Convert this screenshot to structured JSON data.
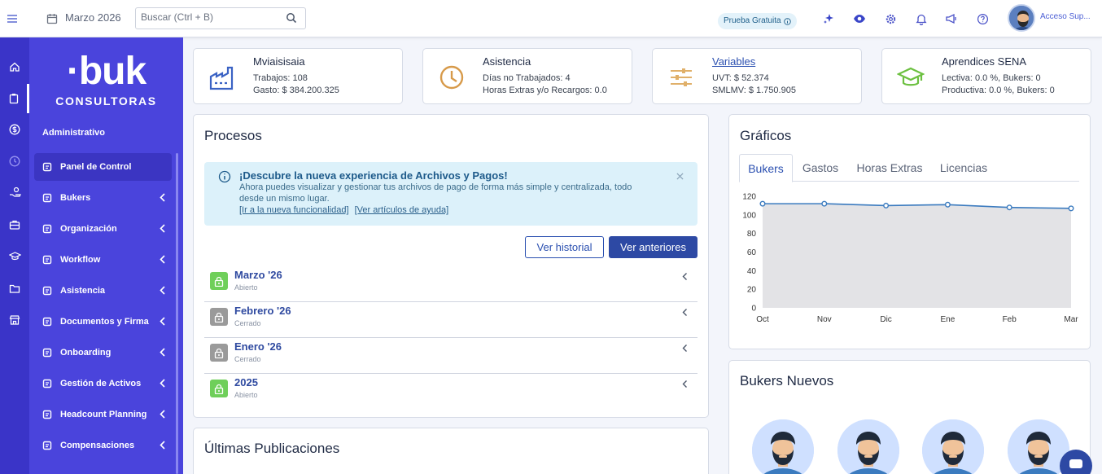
{
  "topbar": {
    "month": "Marzo 2026",
    "search_placeholder": "Buscar (Ctrl + B)",
    "trial_badge": "Prueba Gratuita",
    "user_name": "Acceso Sup..."
  },
  "sidebar": {
    "brand_name": "·buk",
    "brand_sub": "CONSULTORAS",
    "section_label": "Administrativo",
    "items": [
      {
        "label": "Panel de Control",
        "icon": "dashboard-icon",
        "active": true
      },
      {
        "label": "Bukers",
        "icon": "users-icon"
      },
      {
        "label": "Organización",
        "icon": "org-chart-icon"
      },
      {
        "label": "Workflow",
        "icon": "workflow-icon"
      },
      {
        "label": "Asistencia",
        "icon": "calendar-check-icon"
      },
      {
        "label": "Documentos y Firma",
        "icon": "documents-icon"
      },
      {
        "label": "Onboarding",
        "icon": "onboarding-icon"
      },
      {
        "label": "Gestión de Activos",
        "icon": "assets-icon"
      },
      {
        "label": "Headcount Planning",
        "icon": "headcount-icon"
      },
      {
        "label": "Compensaciones",
        "icon": "money-icon"
      }
    ]
  },
  "stats": [
    {
      "title": "Mviaisisaia",
      "line1": "Trabajos: 108",
      "line2": "Gasto: $ 384.200.325",
      "icon": "factory-icon"
    },
    {
      "title": "Asistencia",
      "line1": "Días no Trabajados: 4",
      "line2": "Horas Extras y/o Recargos: 0.0",
      "icon": "clock-icon"
    },
    {
      "title": "Variables",
      "line1": "UVT: $ 52.374",
      "line2": "SMLMV: $ 1.750.905",
      "icon": "sliders-icon"
    },
    {
      "title": "Aprendices SENA",
      "line1": "Lectiva: 0.0 %, Bukers: 0",
      "line2": "Productiva: 0.0 %, Bukers: 0",
      "icon": "graduation-cap-icon"
    }
  ],
  "procesos": {
    "title": "Procesos",
    "banner": {
      "title": "¡Descubre la nueva experiencia de Archivos y Pagos!",
      "text": "Ahora puedes visualizar y gestionar tus archivos de pago de forma más simple y centralizada, todo desde un mismo lugar.",
      "link1": "[Ir a la nueva funcionalidad]",
      "link2": "[Ver artículos de ayuda]"
    },
    "btn_historial": "Ver historial",
    "btn_anteriores": "Ver anteriores",
    "items": [
      {
        "name": "Marzo '26",
        "status": "Abierto",
        "open": true
      },
      {
        "name": "Febrero '26",
        "status": "Cerrado",
        "open": false
      },
      {
        "name": "Enero '26",
        "status": "Cerrado",
        "open": false
      },
      {
        "name": "2025",
        "status": "Abierto",
        "open": true
      }
    ]
  },
  "publicaciones": {
    "title": "Últimas Publicaciones"
  },
  "graficos": {
    "title": "Gráficos",
    "tabs": [
      "Bukers",
      "Gastos",
      "Horas Extras",
      "Licencias"
    ],
    "active_tab": "Bukers"
  },
  "chart_data": {
    "type": "area",
    "x": [
      "Oct",
      "Nov",
      "Dic",
      "Ene",
      "Feb",
      "Mar"
    ],
    "values": [
      112,
      112,
      110,
      111,
      108,
      107
    ],
    "ylim": [
      0,
      120
    ],
    "yticks": [
      0,
      20,
      40,
      60,
      80,
      100,
      120
    ],
    "grid": false,
    "line_color": "#3b7bbf",
    "fill_color": "#e3e3e6"
  },
  "bukers_nuevos": {
    "title": "Bukers Nuevos"
  },
  "colors": {
    "primary": "#2d49a4",
    "sidebar": "#4a44dc",
    "rail": "#3a34c8",
    "open": "#6fcf5a",
    "closed": "#9a9a9a"
  }
}
